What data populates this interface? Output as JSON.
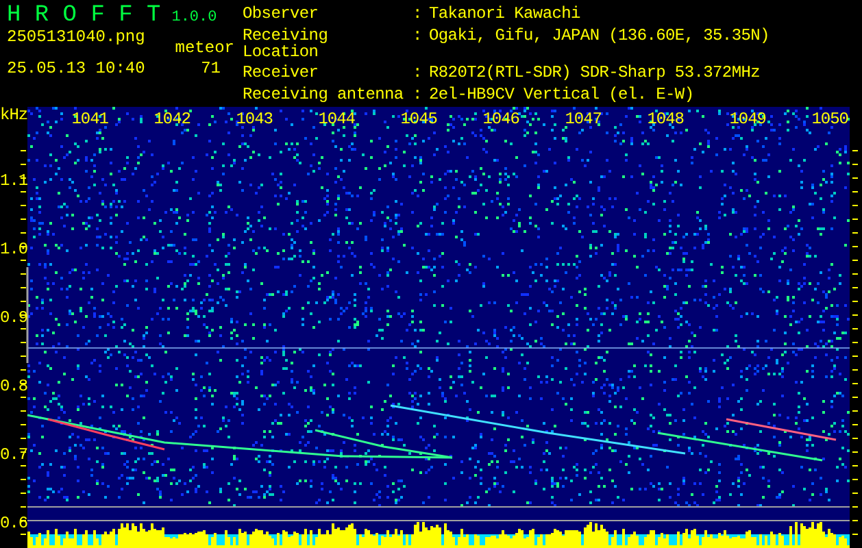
{
  "app": {
    "name": "H R O F F T",
    "version": "1.0.0"
  },
  "file": "2505131040.png",
  "datetime": "25.05.13 10:40",
  "counter": {
    "label": "meteor",
    "value": "71"
  },
  "info_separator": ":",
  "info": [
    {
      "label": "Observer",
      "value": "Takanori Kawachi"
    },
    {
      "label": "Receiving Location",
      "value": "Ogaki, Gifu, JAPAN (136.60E, 35.35N)"
    },
    {
      "label": "Receiver",
      "value": "R820T2(RTL-SDR) SDR-Sharp 53.372MHz"
    },
    {
      "label": "Receiving antenna",
      "value": "2el-HB9CV Vertical (el. E-W)"
    }
  ],
  "plot": {
    "unit": "kHz",
    "x_labels": [
      "1041",
      "1042",
      "1043",
      "1044",
      "1045",
      "1046",
      "1047",
      "1048",
      "1049",
      "1050"
    ],
    "y_labels": [
      "1.1",
      "1.0",
      "0.9",
      "0.8",
      "0.7",
      "0.6"
    ]
  }
}
